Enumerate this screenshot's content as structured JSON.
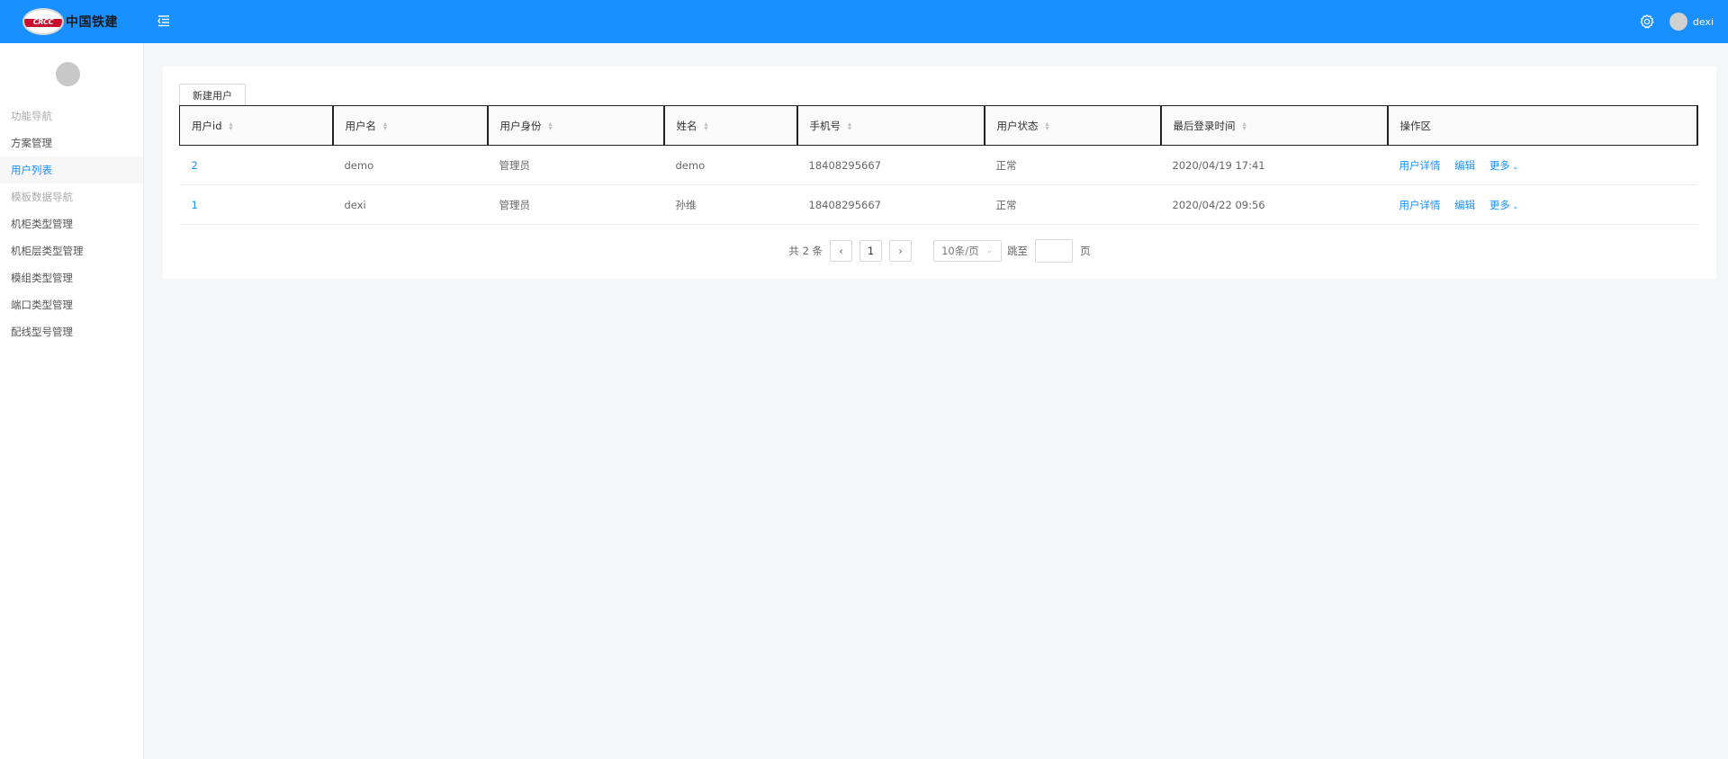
{
  "header": {
    "logo_emblem_text": "CRCC",
    "logo_text": "中国铁建",
    "username": "dexi"
  },
  "sidebar": {
    "groups": [
      {
        "label": "功能导航",
        "items": [
          "方案管理",
          "用户列表"
        ]
      },
      {
        "label": "模板数据导航",
        "items": [
          "机柜类型管理",
          "机柜层类型管理",
          "模组类型管理",
          "端口类型管理",
          "配线型号管理"
        ]
      }
    ],
    "active_item": "用户列表"
  },
  "toolbar": {
    "new_user_label": "新建用户"
  },
  "table": {
    "columns": [
      "用户id",
      "用户名",
      "用户身份",
      "姓名",
      "手机号",
      "用户状态",
      "最后登录时间",
      "操作区"
    ],
    "rows": [
      {
        "id": "2",
        "username": "demo",
        "role": "管理员",
        "name": "demo",
        "phone": "18408295667",
        "status": "正常",
        "last_login": "2020/04/19 17:41"
      },
      {
        "id": "1",
        "username": "dexi",
        "role": "管理员",
        "name": "孙维",
        "phone": "18408295667",
        "status": "正常",
        "last_login": "2020/04/22 09:56"
      }
    ],
    "actions": {
      "detail": "用户详情",
      "edit": "编辑",
      "more": "更多"
    }
  },
  "pagination": {
    "total_label": "共 2 条",
    "current_page": "1",
    "page_size": "10条/页",
    "jump_prefix": "跳至",
    "jump_suffix": "页"
  },
  "colors": {
    "primary": "#1890ff",
    "header_bg": "#1890ff",
    "page_bg": "#f5f6f8"
  }
}
